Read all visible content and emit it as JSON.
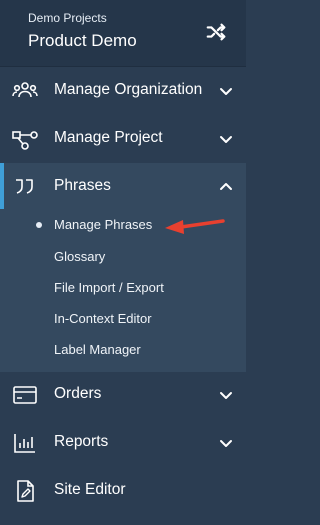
{
  "header": {
    "subtitle": "Demo Projects",
    "title": "Product Demo"
  },
  "nav": {
    "manage_org": "Manage Organization",
    "manage_project": "Manage Project",
    "phrases": "Phrases",
    "orders": "Orders",
    "reports": "Reports",
    "site_editor": "Site Editor"
  },
  "phrases_sub": {
    "manage_phrases": "Manage Phrases",
    "glossary": "Glossary",
    "file_import_export": "File Import / Export",
    "in_context_editor": "In-Context Editor",
    "label_manager": "Label Manager"
  },
  "colors": {
    "sidebar_bg": "#2b3d52",
    "header_bg": "#25364a",
    "active_section_bg": "#34495f",
    "accent": "#3f9fd8",
    "annotation_arrow": "#e8402f"
  }
}
